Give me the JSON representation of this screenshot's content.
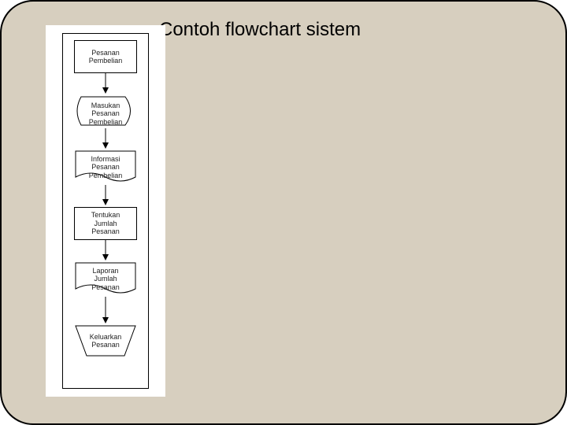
{
  "title": "Contoh flowchart sistem",
  "flow": {
    "n1": {
      "label": "Pesanan\nPembelian",
      "shape": "rectangle"
    },
    "n2": {
      "label": "Masukan\nPesanan\nPembelian",
      "shape": "display"
    },
    "n3": {
      "label": "Informasi\nPesanan\nPembelian",
      "shape": "document"
    },
    "n4": {
      "label": "Tentukan\nJumlah\nPesanan",
      "shape": "rectangle"
    },
    "n5": {
      "label": "Laporan\nJumlah\nPesanan",
      "shape": "document"
    },
    "n6": {
      "label": "Keluarkan\nPesanan",
      "shape": "manual-operation"
    }
  }
}
